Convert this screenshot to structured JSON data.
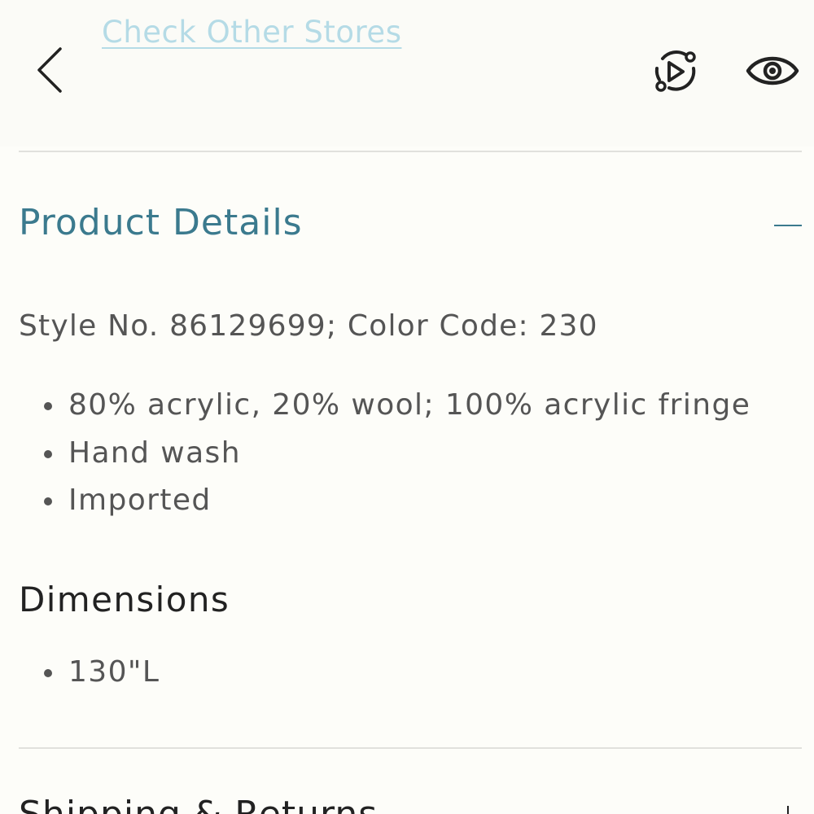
{
  "header": {
    "store_link_label": "Check Other Stores",
    "back_icon": "chevron-left-icon",
    "video_icon": "play-circle-icon",
    "view_icon": "eye-icon"
  },
  "product_details": {
    "title": "Product Details",
    "toggle_icon": "minus-icon",
    "style_line": "Style No. 86129699; Color Code: 230",
    "bullets": [
      "80% acrylic, 20% wool; 100% acrylic fringe",
      "Hand wash",
      "Imported"
    ]
  },
  "dimensions": {
    "title": "Dimensions",
    "bullets": [
      "130\"L"
    ]
  },
  "next_section": {
    "title": "Shipping & Returns",
    "toggle_icon": "plus-icon"
  },
  "colors": {
    "accent": "#3b7a8e",
    "link": "#b5dbe6",
    "body_text": "#555555",
    "heading_text": "#222222",
    "divider": "#e1e1dd",
    "background": "#fdfdf9"
  }
}
